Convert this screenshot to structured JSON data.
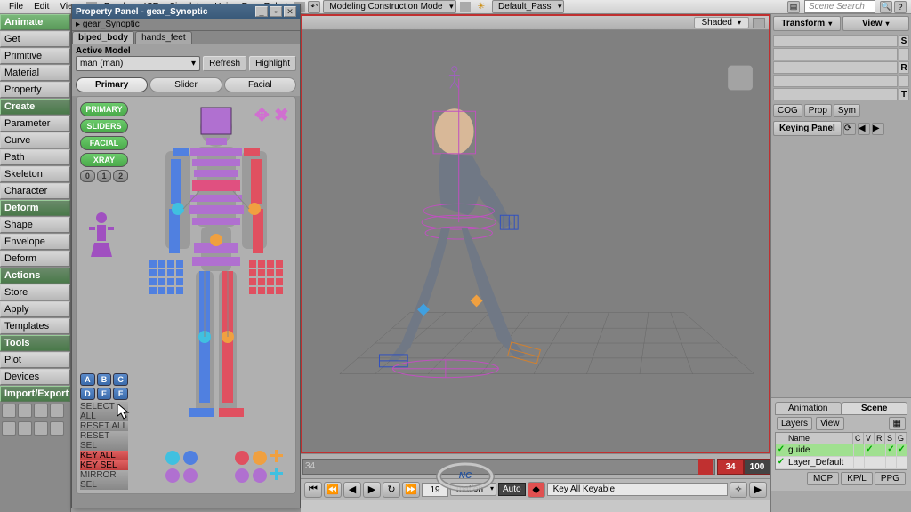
{
  "menubar": {
    "items": [
      "File",
      "Edit",
      "View",
      "Render",
      "ICE",
      "Simulate",
      "Hair",
      "Face Robot"
    ],
    "mode": "Modeling Construction Mode",
    "pass": "Default_Pass",
    "pass_prefix": "✳",
    "search_placeholder": "Scene Search"
  },
  "leftcol": {
    "groups": [
      {
        "name": "Animate",
        "items": [
          "Get",
          "Primitive",
          "Material",
          "Property"
        ]
      },
      {
        "name": "Create",
        "items": [
          "Parameter",
          "Curve",
          "Path",
          "Skeleton",
          "Character"
        ]
      },
      {
        "name": "Deform",
        "items": [
          "Shape",
          "Envelope",
          "Deform"
        ]
      },
      {
        "name": "Actions",
        "items": [
          "Store",
          "Apply",
          "Templates"
        ]
      },
      {
        "name": "Tools",
        "items": [
          "Plot",
          "Devices"
        ]
      },
      {
        "name": "Import/Export",
        "items": []
      }
    ]
  },
  "proppanel": {
    "title": "Property Panel - gear_Synoptic",
    "breadcrumb": "gear_Synoptic",
    "tabs": [
      "biped_body",
      "hands_feet"
    ],
    "active_tab": 0,
    "active_model_label": "Active Model",
    "active_model": "man (man)",
    "refresh": "Refresh",
    "highlight": "Highlight",
    "pages": [
      "Primary",
      "Slider",
      "Facial"
    ],
    "active_page": 0,
    "side_buttons": [
      {
        "label": "PRIMARY",
        "cls": "green"
      },
      {
        "label": "SLIDERS",
        "cls": "green"
      },
      {
        "label": "FACIAL",
        "cls": "green"
      },
      {
        "label": "XRAY",
        "cls": "green"
      }
    ],
    "nums": [
      "0",
      "1",
      "2"
    ],
    "letters1": [
      "A",
      "B",
      "C"
    ],
    "letters2": [
      "D",
      "E",
      "F"
    ],
    "action_buttons": [
      {
        "label": "SELECT ALL",
        "cls": "grey"
      },
      {
        "label": "RESET ALL",
        "cls": "grey"
      },
      {
        "label": "RESET SEL",
        "cls": "grey"
      },
      {
        "label": "KEY ALL",
        "cls": "red"
      },
      {
        "label": "KEY SEL",
        "cls": "red"
      },
      {
        "label": "MIRROR SEL",
        "cls": "grey"
      }
    ]
  },
  "viewport": {
    "shade_mode": "Shaded"
  },
  "rightcol": {
    "top": [
      "Transform",
      "View"
    ],
    "mid_cog": "COG",
    "mid_prop": "Prop",
    "mid_sym": "Sym",
    "keying_panel": "Keying Panel",
    "outliner_tabs": [
      "Animation",
      "Scene"
    ],
    "outliner_active": 1,
    "layers_label": "Layers",
    "view_label": "View",
    "columns": [
      "",
      "Name",
      "C",
      "V",
      "R",
      "S",
      "G"
    ],
    "rows": [
      {
        "name": "guide",
        "cls": "green"
      },
      {
        "name": "Layer_Default",
        "cls": ""
      }
    ],
    "bottom": [
      "MCP",
      "KP/L",
      "PPG"
    ]
  },
  "timeline": {
    "label": "34",
    "current": "34",
    "end": "100"
  },
  "playbar": {
    "cur": "19",
    "mode": "mation",
    "auto": "Auto",
    "keymode": "Key All Keyable"
  },
  "xform_side_labels": [
    "S",
    "R",
    "T"
  ]
}
